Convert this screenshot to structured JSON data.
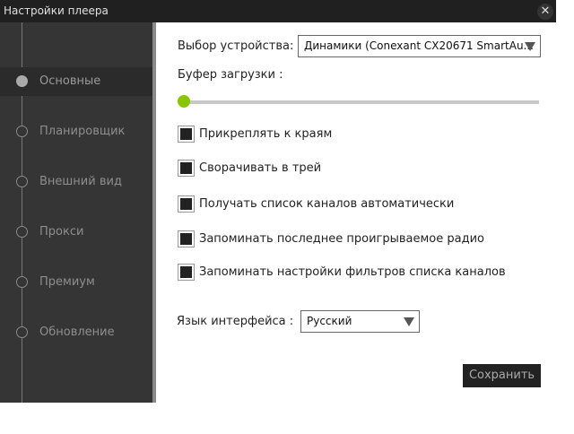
{
  "window": {
    "title": "Настройки плеера",
    "close_icon": "close-icon"
  },
  "sidebar": {
    "items": [
      {
        "label": "Основные",
        "active": true
      },
      {
        "label": "Планировщик"
      },
      {
        "label": "Внешний вид"
      },
      {
        "label": "Прокси"
      },
      {
        "label": "Премиум"
      },
      {
        "label": "Обновление"
      }
    ]
  },
  "main": {
    "device_label": "Выбор устройства:",
    "device_value": "Динамики (Conexant CX20671 SmartAu...",
    "buffer_label": "Буфер загрузки :",
    "buffer_value": 0,
    "accent": "#8bc400",
    "checkboxes": [
      {
        "label": "Прикреплять к краям",
        "checked": true
      },
      {
        "label": "Сворачивать в трей",
        "checked": true
      },
      {
        "label": "Получать список каналов автоматически",
        "checked": true
      },
      {
        "label": "Запоминать последнее проигрываемое радио",
        "checked": true
      },
      {
        "label": "Запоминать настройки фильтров списка каналов",
        "checked": true
      }
    ],
    "language_label": "Язык интерфейса :",
    "language_value": "Русский",
    "save_label": "Сохранить"
  }
}
